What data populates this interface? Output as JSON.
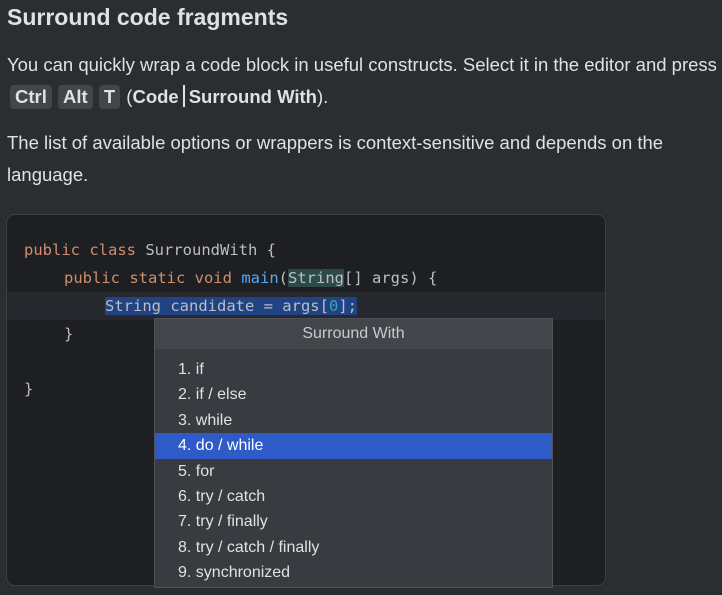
{
  "heading": "Surround code fragments",
  "intro": {
    "text_before": "You can quickly wrap a code block in useful constructs. Select it in the editor and press",
    "keys": [
      "Ctrl",
      "Alt",
      "T"
    ],
    "paren_open": "(",
    "menu_path": [
      "Code",
      "Surround With"
    ],
    "paren_close": ")."
  },
  "note": "The list of available options or wrappers is context-sensitive and depends on the language.",
  "code": {
    "line1": {
      "kw": "public class",
      "name": "SurroundWith",
      "tail": "{"
    },
    "line2": {
      "kw": "public static void",
      "fn": "main",
      "open": "(",
      "type": "String",
      "rest": "[] args) {"
    },
    "line3": {
      "text": "String candidate = args[",
      "num": "0",
      "end": "];"
    },
    "line4": "}",
    "line5": "}"
  },
  "popup": {
    "title": "Surround With",
    "items": [
      {
        "label": "1. if"
      },
      {
        "label": "2. if / else"
      },
      {
        "label": "3. while"
      },
      {
        "label": "4. do / while"
      },
      {
        "label": "5. for"
      },
      {
        "label": "6. try / catch"
      },
      {
        "label": "7. try / finally"
      },
      {
        "label": "8. try / catch / finally"
      },
      {
        "label": "9. synchronized"
      }
    ],
    "selected_index": 3
  },
  "colors": {
    "background": "#2b2d30",
    "editor_background": "#1e1f22",
    "keyword": "#cf8e6d",
    "function": "#56a8f5",
    "number": "#2aacb8",
    "selection": "#214283",
    "menu_selection": "#2e5bc7"
  }
}
